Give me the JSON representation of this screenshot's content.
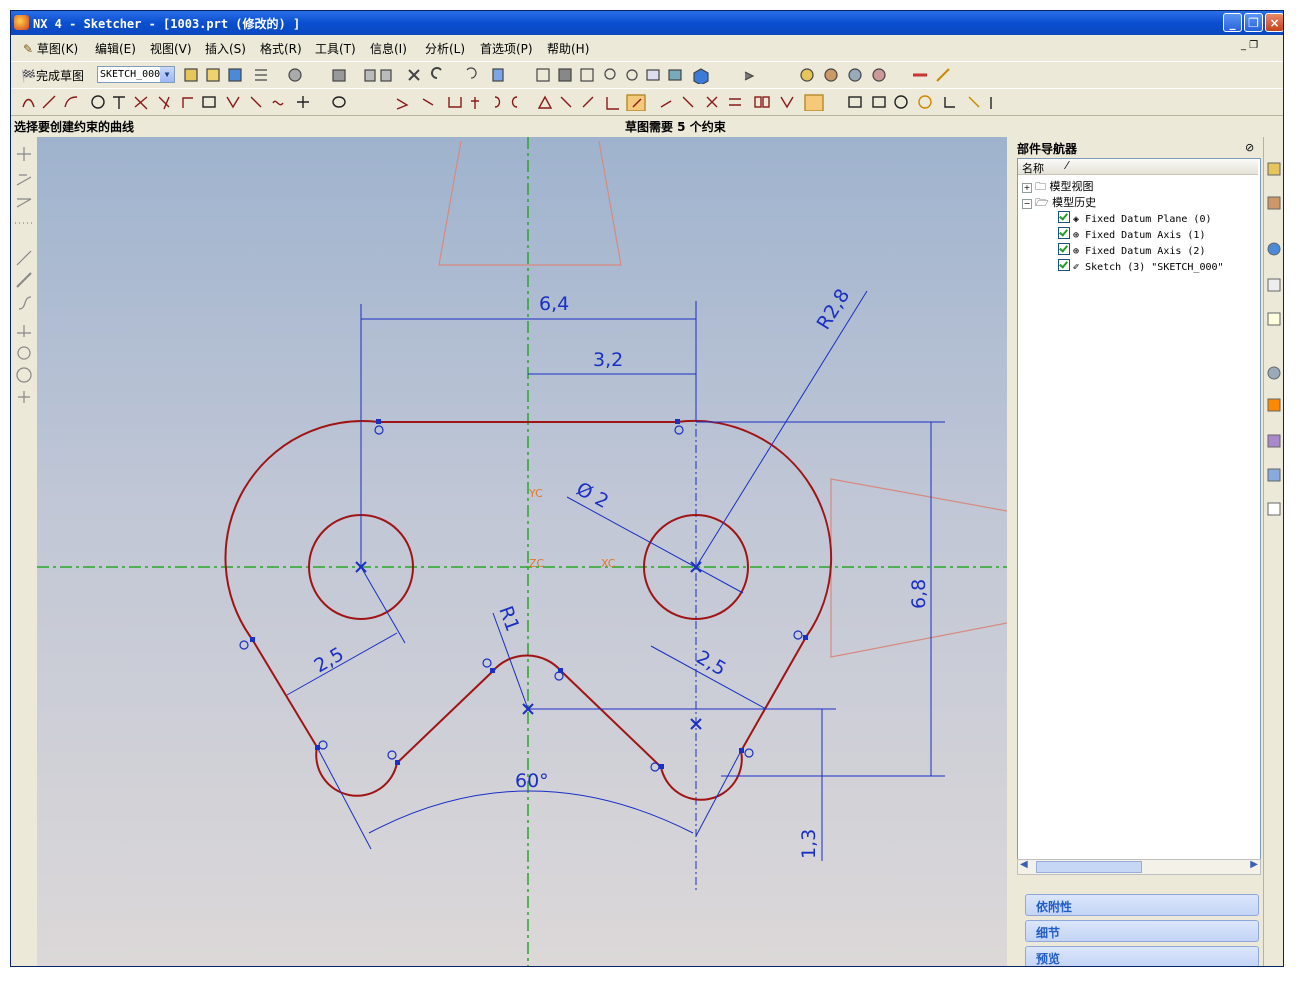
{
  "window": {
    "title": "NX 4 - Sketcher - [1003.prt  (修改的) ]",
    "minimize": "_",
    "restore": "❐",
    "close": "×"
  },
  "menu": [
    {
      "label": "草图(K)",
      "icon": "pencil-icon"
    },
    {
      "label": "编辑(E)"
    },
    {
      "label": "视图(V)"
    },
    {
      "label": "插入(S)"
    },
    {
      "label": "格式(R)"
    },
    {
      "label": "工具(T)"
    },
    {
      "label": "信息(I)"
    },
    {
      "label": "分析(L)"
    },
    {
      "label": "首选项(P)"
    },
    {
      "label": "帮助(H)"
    }
  ],
  "toolbar1": {
    "finish_sketch": "完成草图",
    "sketch_name": "SKETCH_000"
  },
  "status": {
    "prompt": "选择要创建约束的曲线",
    "constraints": "草图需要 5 个约束"
  },
  "canvas": {
    "dimensions": {
      "width_total": "6,4",
      "width_half": "3,2",
      "radius_outer": "R2,8",
      "hole_diameter": "Ø 2",
      "height": "6,8",
      "offset_left": "2,5",
      "offset_right": "2,5",
      "fillet": "R1",
      "angle": "60°",
      "depth": "1,3"
    },
    "axis_labels": {
      "yc": "YC",
      "zc": "ZC",
      "xc": "XC"
    },
    "colors": {
      "profile": "#a01414",
      "dimension": "#1a2fc4",
      "centerline": "#2aa52a",
      "datum": "#d78a80"
    }
  },
  "navigator": {
    "title": "部件导航器",
    "column": "名称",
    "items": [
      {
        "label": "模型视图",
        "type": "folder"
      },
      {
        "label": "模型历史",
        "type": "folder-open"
      },
      {
        "label": "Fixed Datum Plane (0)"
      },
      {
        "label": "Fixed Datum Axis (1)"
      },
      {
        "label": "Fixed Datum Axis (2)"
      },
      {
        "label": "Sketch (3) \"SKETCH_000\""
      }
    ],
    "panels": [
      "依附性",
      "细节",
      "预览"
    ]
  }
}
